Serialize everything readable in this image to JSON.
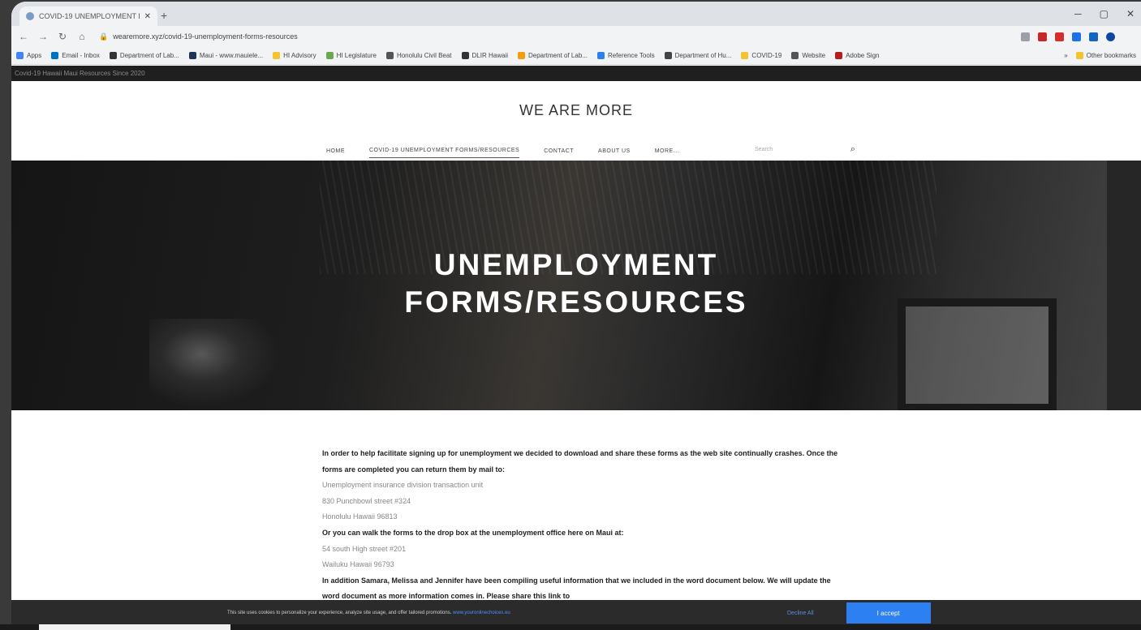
{
  "browser": {
    "tab_title": "COVID-19 UNEMPLOYMENT FO...",
    "url": "wearemore.xyz/covid-19-unemployment-forms-resources",
    "bookmarks": [
      "Apps",
      "Email - Inbox",
      "Department of Lab...",
      "Maui - www.mauiele...",
      "HI Advisory",
      "HI Legislature",
      "Honolulu Civil Beat",
      "DLIR Hawaii",
      "Department of Lab...",
      "Reference Tools",
      "Department of Hu...",
      "COVID-19",
      "Website",
      "Adobe Sign"
    ],
    "other_bookmarks": "Other bookmarks"
  },
  "site": {
    "topbar_text": "Covid-19 Hawaii Maui Resources Since 2020",
    "title": "WE ARE MORE",
    "nav": {
      "home": "HOME",
      "covid": "COVID-19 UNEMPLOYMENT FORMS/RESOURCES",
      "contact": "CONTACT",
      "about": "ABOUT US",
      "more": "MORE..."
    },
    "search_placeholder": "Search"
  },
  "hero": {
    "line1": "UNEMPLOYMENT",
    "line2": "FORMS/RESOURCES"
  },
  "content": {
    "p1": "In order to help facilitate signing up for unemployment we decided to download and share these forms as the web site continually crashes. Once the forms are completed you can return them by mail to:",
    "addr1_l1": "Unemployment insurance division transaction unit",
    "addr1_l2": "830 Punchbowl street #324",
    "addr1_l3": "Honolulu Hawaii 96813",
    "p2": "Or you can walk the forms to the drop box at the unemployment office here on Maui at:",
    "addr2_l1": "54 south High street #201",
    "addr2_l2": "Wailuku Hawaii 96793",
    "p3": "In addition Samara, Melissa and Jennifer have been compiling useful information that we included in the word document below. We will update the word document as more information comes in. Please share this link to"
  },
  "cookie": {
    "message": "This site uses cookies to personalize your experience, analyze site usage, and offer tailored promotions.",
    "link": "www.youronlinechoices.eu",
    "decline": "Decline All",
    "accept": "I accept"
  }
}
